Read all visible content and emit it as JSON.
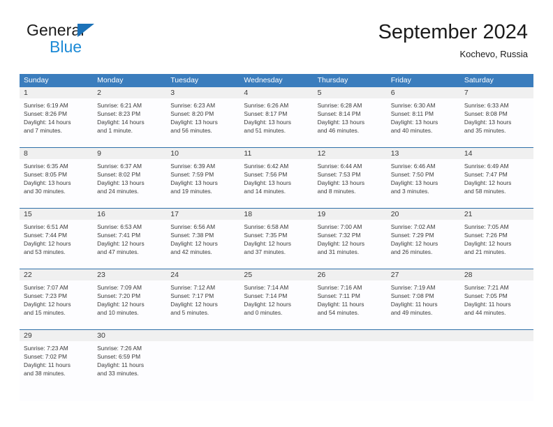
{
  "brand": {
    "name_part1": "General",
    "name_part2": "Blue",
    "triangle_color": "#1c72b8",
    "blue_color": "#1c8ad6"
  },
  "header": {
    "title": "September 2024",
    "location": "Kochevo, Russia"
  },
  "theme": {
    "header_bg": "#3b7dbd",
    "header_text": "#ffffff",
    "daynum_bg": "#f0f0f0",
    "cell_bg": "#fdfdff",
    "row_divider": "#2e6fa8",
    "body_text": "#3a3a3a"
  },
  "calendar": {
    "weekdays": [
      "Sunday",
      "Monday",
      "Tuesday",
      "Wednesday",
      "Thursday",
      "Friday",
      "Saturday"
    ],
    "weeks": [
      [
        {
          "day": "1",
          "sunrise": "Sunrise: 6:19 AM",
          "sunset": "Sunset: 8:26 PM",
          "daylight1": "Daylight: 14 hours",
          "daylight2": "and 7 minutes."
        },
        {
          "day": "2",
          "sunrise": "Sunrise: 6:21 AM",
          "sunset": "Sunset: 8:23 PM",
          "daylight1": "Daylight: 14 hours",
          "daylight2": "and 1 minute."
        },
        {
          "day": "3",
          "sunrise": "Sunrise: 6:23 AM",
          "sunset": "Sunset: 8:20 PM",
          "daylight1": "Daylight: 13 hours",
          "daylight2": "and 56 minutes."
        },
        {
          "day": "4",
          "sunrise": "Sunrise: 6:26 AM",
          "sunset": "Sunset: 8:17 PM",
          "daylight1": "Daylight: 13 hours",
          "daylight2": "and 51 minutes."
        },
        {
          "day": "5",
          "sunrise": "Sunrise: 6:28 AM",
          "sunset": "Sunset: 8:14 PM",
          "daylight1": "Daylight: 13 hours",
          "daylight2": "and 46 minutes."
        },
        {
          "day": "6",
          "sunrise": "Sunrise: 6:30 AM",
          "sunset": "Sunset: 8:11 PM",
          "daylight1": "Daylight: 13 hours",
          "daylight2": "and 40 minutes."
        },
        {
          "day": "7",
          "sunrise": "Sunrise: 6:33 AM",
          "sunset": "Sunset: 8:08 PM",
          "daylight1": "Daylight: 13 hours",
          "daylight2": "and 35 minutes."
        }
      ],
      [
        {
          "day": "8",
          "sunrise": "Sunrise: 6:35 AM",
          "sunset": "Sunset: 8:05 PM",
          "daylight1": "Daylight: 13 hours",
          "daylight2": "and 30 minutes."
        },
        {
          "day": "9",
          "sunrise": "Sunrise: 6:37 AM",
          "sunset": "Sunset: 8:02 PM",
          "daylight1": "Daylight: 13 hours",
          "daylight2": "and 24 minutes."
        },
        {
          "day": "10",
          "sunrise": "Sunrise: 6:39 AM",
          "sunset": "Sunset: 7:59 PM",
          "daylight1": "Daylight: 13 hours",
          "daylight2": "and 19 minutes."
        },
        {
          "day": "11",
          "sunrise": "Sunrise: 6:42 AM",
          "sunset": "Sunset: 7:56 PM",
          "daylight1": "Daylight: 13 hours",
          "daylight2": "and 14 minutes."
        },
        {
          "day": "12",
          "sunrise": "Sunrise: 6:44 AM",
          "sunset": "Sunset: 7:53 PM",
          "daylight1": "Daylight: 13 hours",
          "daylight2": "and 8 minutes."
        },
        {
          "day": "13",
          "sunrise": "Sunrise: 6:46 AM",
          "sunset": "Sunset: 7:50 PM",
          "daylight1": "Daylight: 13 hours",
          "daylight2": "and 3 minutes."
        },
        {
          "day": "14",
          "sunrise": "Sunrise: 6:49 AM",
          "sunset": "Sunset: 7:47 PM",
          "daylight1": "Daylight: 12 hours",
          "daylight2": "and 58 minutes."
        }
      ],
      [
        {
          "day": "15",
          "sunrise": "Sunrise: 6:51 AM",
          "sunset": "Sunset: 7:44 PM",
          "daylight1": "Daylight: 12 hours",
          "daylight2": "and 53 minutes."
        },
        {
          "day": "16",
          "sunrise": "Sunrise: 6:53 AM",
          "sunset": "Sunset: 7:41 PM",
          "daylight1": "Daylight: 12 hours",
          "daylight2": "and 47 minutes."
        },
        {
          "day": "17",
          "sunrise": "Sunrise: 6:56 AM",
          "sunset": "Sunset: 7:38 PM",
          "daylight1": "Daylight: 12 hours",
          "daylight2": "and 42 minutes."
        },
        {
          "day": "18",
          "sunrise": "Sunrise: 6:58 AM",
          "sunset": "Sunset: 7:35 PM",
          "daylight1": "Daylight: 12 hours",
          "daylight2": "and 37 minutes."
        },
        {
          "day": "19",
          "sunrise": "Sunrise: 7:00 AM",
          "sunset": "Sunset: 7:32 PM",
          "daylight1": "Daylight: 12 hours",
          "daylight2": "and 31 minutes."
        },
        {
          "day": "20",
          "sunrise": "Sunrise: 7:02 AM",
          "sunset": "Sunset: 7:29 PM",
          "daylight1": "Daylight: 12 hours",
          "daylight2": "and 26 minutes."
        },
        {
          "day": "21",
          "sunrise": "Sunrise: 7:05 AM",
          "sunset": "Sunset: 7:26 PM",
          "daylight1": "Daylight: 12 hours",
          "daylight2": "and 21 minutes."
        }
      ],
      [
        {
          "day": "22",
          "sunrise": "Sunrise: 7:07 AM",
          "sunset": "Sunset: 7:23 PM",
          "daylight1": "Daylight: 12 hours",
          "daylight2": "and 15 minutes."
        },
        {
          "day": "23",
          "sunrise": "Sunrise: 7:09 AM",
          "sunset": "Sunset: 7:20 PM",
          "daylight1": "Daylight: 12 hours",
          "daylight2": "and 10 minutes."
        },
        {
          "day": "24",
          "sunrise": "Sunrise: 7:12 AM",
          "sunset": "Sunset: 7:17 PM",
          "daylight1": "Daylight: 12 hours",
          "daylight2": "and 5 minutes."
        },
        {
          "day": "25",
          "sunrise": "Sunrise: 7:14 AM",
          "sunset": "Sunset: 7:14 PM",
          "daylight1": "Daylight: 12 hours",
          "daylight2": "and 0 minutes."
        },
        {
          "day": "26",
          "sunrise": "Sunrise: 7:16 AM",
          "sunset": "Sunset: 7:11 PM",
          "daylight1": "Daylight: 11 hours",
          "daylight2": "and 54 minutes."
        },
        {
          "day": "27",
          "sunrise": "Sunrise: 7:19 AM",
          "sunset": "Sunset: 7:08 PM",
          "daylight1": "Daylight: 11 hours",
          "daylight2": "and 49 minutes."
        },
        {
          "day": "28",
          "sunrise": "Sunrise: 7:21 AM",
          "sunset": "Sunset: 7:05 PM",
          "daylight1": "Daylight: 11 hours",
          "daylight2": "and 44 minutes."
        }
      ],
      [
        {
          "day": "29",
          "sunrise": "Sunrise: 7:23 AM",
          "sunset": "Sunset: 7:02 PM",
          "daylight1": "Daylight: 11 hours",
          "daylight2": "and 38 minutes."
        },
        {
          "day": "30",
          "sunrise": "Sunrise: 7:26 AM",
          "sunset": "Sunset: 6:59 PM",
          "daylight1": "Daylight: 11 hours",
          "daylight2": "and 33 minutes."
        },
        {
          "day": "",
          "sunrise": "",
          "sunset": "",
          "daylight1": "",
          "daylight2": ""
        },
        {
          "day": "",
          "sunrise": "",
          "sunset": "",
          "daylight1": "",
          "daylight2": ""
        },
        {
          "day": "",
          "sunrise": "",
          "sunset": "",
          "daylight1": "",
          "daylight2": ""
        },
        {
          "day": "",
          "sunrise": "",
          "sunset": "",
          "daylight1": "",
          "daylight2": ""
        },
        {
          "day": "",
          "sunrise": "",
          "sunset": "",
          "daylight1": "",
          "daylight2": ""
        }
      ]
    ]
  }
}
